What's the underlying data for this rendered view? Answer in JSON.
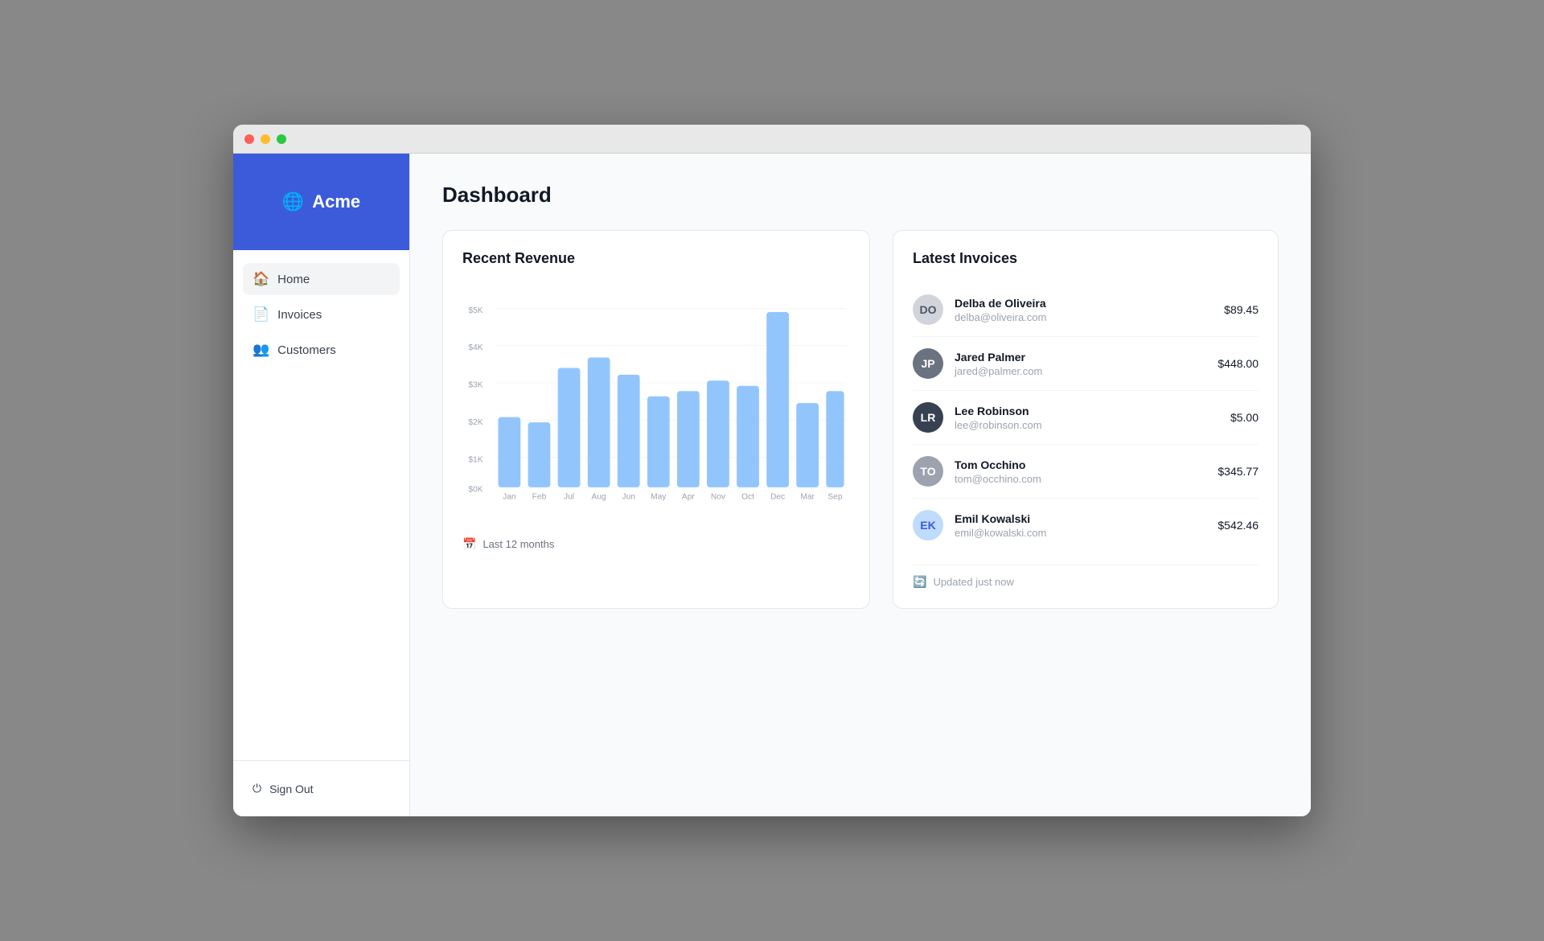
{
  "app": {
    "name": "Acme",
    "logo_icon": "🌐"
  },
  "sidebar": {
    "nav_items": [
      {
        "id": "home",
        "label": "Home",
        "icon": "🏠",
        "active": true
      },
      {
        "id": "invoices",
        "label": "Invoices",
        "icon": "📄",
        "active": false
      },
      {
        "id": "customers",
        "label": "Customers",
        "icon": "👥",
        "active": false
      }
    ],
    "sign_out_label": "Sign Out",
    "sign_out_icon": "⏻"
  },
  "main": {
    "page_title": "Dashboard",
    "revenue_section": {
      "title": "Recent Revenue",
      "footer_label": "Last 12 months",
      "chart": {
        "y_labels": [
          "$5K",
          "$4K",
          "$3K",
          "$2K",
          "$1K",
          "$0K"
        ],
        "bars": [
          {
            "month": "Jan",
            "value": 2000,
            "height_pct": 39
          },
          {
            "month": "Feb",
            "value": 1850,
            "height_pct": 36
          },
          {
            "month": "Jul",
            "value": 3400,
            "height_pct": 66
          },
          {
            "month": "Aug",
            "value": 3700,
            "height_pct": 72
          },
          {
            "month": "Jun",
            "value": 3200,
            "height_pct": 62
          },
          {
            "month": "May",
            "value": 2600,
            "height_pct": 50
          },
          {
            "month": "Apr",
            "value": 2750,
            "height_pct": 53
          },
          {
            "month": "Nov",
            "value": 3050,
            "height_pct": 59
          },
          {
            "month": "Oct",
            "value": 2900,
            "height_pct": 56
          },
          {
            "month": "Dec",
            "value": 5000,
            "height_pct": 97
          },
          {
            "month": "Mar",
            "value": 2400,
            "height_pct": 46
          },
          {
            "month": "Sep",
            "value": 2750,
            "height_pct": 53
          }
        ]
      }
    },
    "invoices_section": {
      "title": "Latest Invoices",
      "footer_label": "Updated just now",
      "invoices": [
        {
          "name": "Delba de Oliveira",
          "email": "delba@oliveira.com",
          "amount": "$89.45",
          "initials": "DO",
          "avatar_color": "#9ca3af"
        },
        {
          "name": "Jared Palmer",
          "email": "jared@palmer.com",
          "amount": "$448.00",
          "initials": "JP",
          "avatar_color": "#6b7280"
        },
        {
          "name": "Lee Robinson",
          "email": "lee@robinson.com",
          "amount": "$5.00",
          "initials": "LR",
          "avatar_color": "#4b5563"
        },
        {
          "name": "Tom Occhino",
          "email": "tom@occhino.com",
          "amount": "$345.77",
          "initials": "TO",
          "avatar_color": "#9ca3af"
        },
        {
          "name": "Emil Kowalski",
          "email": "emil@kowalski.com",
          "amount": "$542.46",
          "initials": "EK",
          "avatar_color": "#93c5fd"
        }
      ]
    }
  }
}
